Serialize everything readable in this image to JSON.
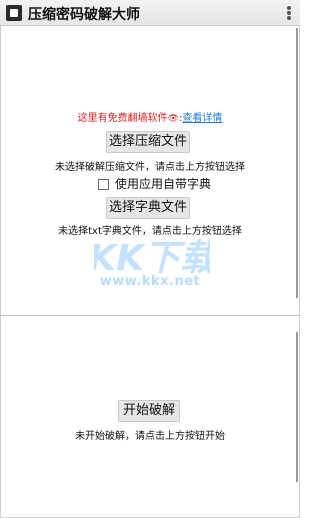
{
  "app": {
    "title": "压缩密码破解大师"
  },
  "promo": {
    "text": "这里有免费翻墙软件",
    "link_label": "查看详情",
    "eye": "👁",
    "separator": ":"
  },
  "archive": {
    "button_label": "选择压缩文件",
    "status": "未选择破解压缩文件，请点击上方按钮选择"
  },
  "dictionary": {
    "use_builtin_label": "使用应用自带字典",
    "button_label": "选择字典文件",
    "status": "未选择txt字典文件，请点击上方按钮选择"
  },
  "crack": {
    "button_label": "开始破解",
    "status": "未开始破解，请点击上方按钮开始"
  },
  "watermark": {
    "logo_text": "KK下载",
    "url": "www.kkx.net"
  },
  "colors": {
    "promo_red": "#e02020",
    "link_blue": "#1e78d6",
    "watermark_blue": "#78beff"
  },
  "icons": {
    "app": "app-icon",
    "overflow": "overflow-menu-icon",
    "checkbox": "checkbox-icon"
  }
}
